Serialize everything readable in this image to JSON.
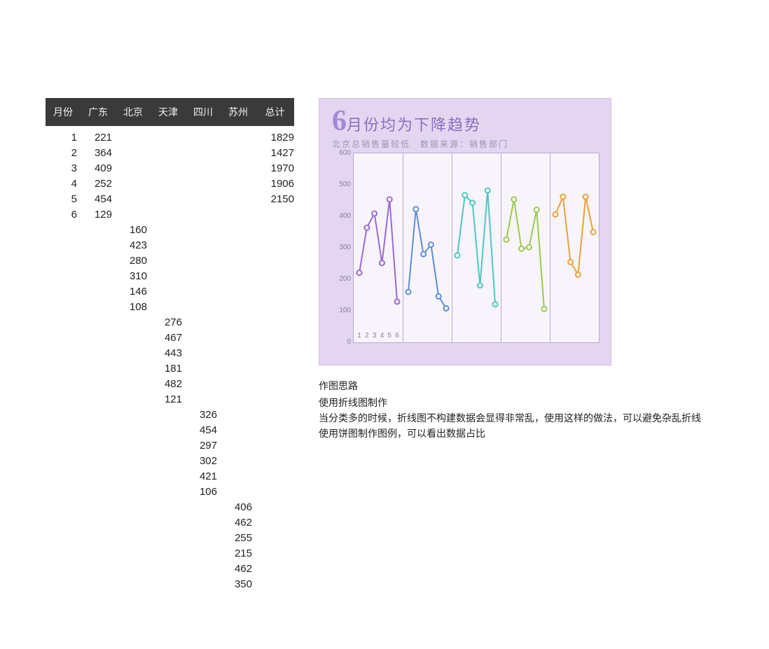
{
  "table": {
    "headers": {
      "month": "月份",
      "gd": "广东",
      "bj": "北京",
      "tj": "天津",
      "sc": "四川",
      "sz": "苏州",
      "total": "总计"
    },
    "months": [
      "1",
      "2",
      "3",
      "4",
      "5",
      "6"
    ],
    "gd": [
      "221",
      "364",
      "409",
      "252",
      "454",
      "129"
    ],
    "bj": [
      "160",
      "423",
      "280",
      "310",
      "146",
      "108"
    ],
    "tj": [
      "276",
      "467",
      "443",
      "181",
      "482",
      "121"
    ],
    "sc": [
      "326",
      "454",
      "297",
      "302",
      "421",
      "106"
    ],
    "sz": [
      "406",
      "462",
      "255",
      "215",
      "462",
      "350"
    ],
    "total": [
      "1829",
      "1427",
      "1970",
      "1906",
      "2150"
    ]
  },
  "chart_meta": {
    "title_prefix": "6",
    "title_rest": "月份均为下降趋势",
    "subtitle": "北京总销售量较低　数据来源：销售部门"
  },
  "chart_data": {
    "type": "line",
    "categories": [
      "1",
      "2",
      "3",
      "4",
      "5",
      "6"
    ],
    "ylim": [
      0,
      600
    ],
    "yticks": [
      0,
      100,
      200,
      300,
      400,
      500,
      600
    ],
    "xlabel": "",
    "ylabel": "",
    "series": [
      {
        "name": "广东",
        "color": "#9b6ad0",
        "values": [
          221,
          364,
          409,
          252,
          454,
          129
        ]
      },
      {
        "name": "北京",
        "color": "#5b8fd6",
        "values": [
          160,
          423,
          280,
          310,
          146,
          108
        ]
      },
      {
        "name": "天津",
        "color": "#4fc7c0",
        "values": [
          276,
          467,
          443,
          181,
          482,
          121
        ]
      },
      {
        "name": "四川",
        "color": "#9cc94e",
        "values": [
          326,
          454,
          297,
          302,
          421,
          106
        ]
      },
      {
        "name": "苏州",
        "color": "#e8a23e",
        "values": [
          406,
          462,
          255,
          215,
          462,
          350
        ]
      }
    ]
  },
  "notes": {
    "heading": "作图思路",
    "l1": "使用折线图制作",
    "l2": "当分类多的时候，折线图不构建数据会显得非常乱，使用这样的做法，可以避免杂乱折线",
    "l3": "使用饼图制作图例，可以看出数据占比"
  }
}
